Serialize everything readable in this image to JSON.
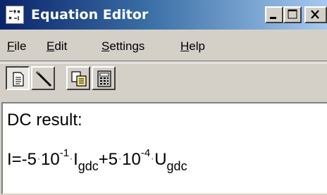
{
  "window": {
    "title": "Equation Editor",
    "controls": {
      "minimize": "_",
      "maximize": "□",
      "close": "✕"
    }
  },
  "menu": {
    "items": [
      {
        "label": "File",
        "mnemonic": "F",
        "rest": "ile"
      },
      {
        "label": "Edit",
        "mnemonic": "E",
        "rest": "dit"
      },
      {
        "label": "Settings",
        "mnemonic": "S",
        "rest": "ettings"
      },
      {
        "label": "Help",
        "mnemonic": "H",
        "rest": "elp"
      }
    ]
  },
  "toolbar": {
    "buttons": [
      {
        "icon": "document-icon",
        "pressed": true
      },
      {
        "icon": "pen-icon",
        "pressed": false
      },
      {
        "icon": "copy-icon",
        "pressed": false
      },
      {
        "icon": "calculator-icon",
        "pressed": false
      }
    ]
  },
  "content": {
    "heading": "DC result:",
    "equation": {
      "lhs": "I=-5",
      "dot": "·",
      "base1": "10",
      "exp1": "-1",
      "var1": "I",
      "sub1": "gdc",
      "plus": "+5",
      "base2": "10",
      "exp2": "-4",
      "var2": "U",
      "sub2": "gdc"
    }
  }
}
